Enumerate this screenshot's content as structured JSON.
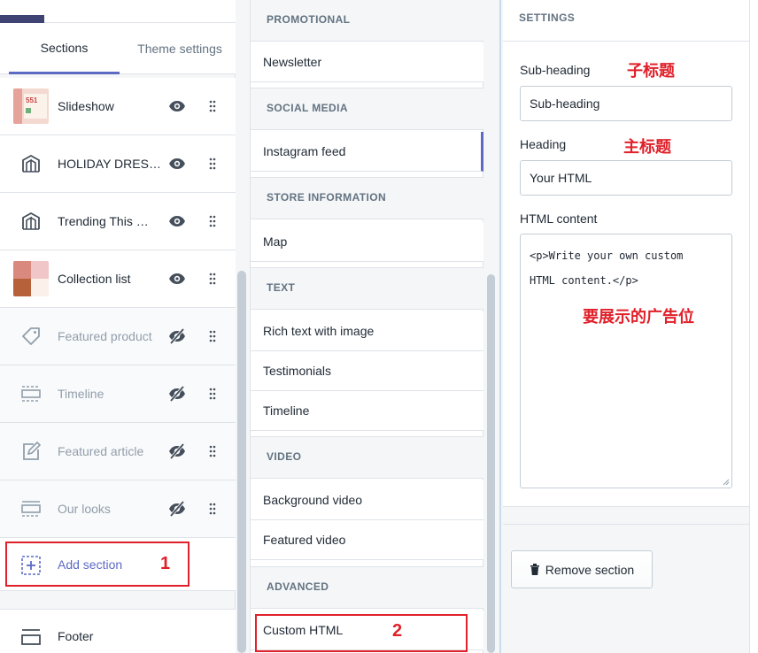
{
  "tabs": {
    "sections": "Sections",
    "theme_settings": "Theme settings"
  },
  "sections": [
    {
      "label": "Slideshow",
      "icon": "image-thumb",
      "visible": true
    },
    {
      "label": "HOLIDAY DRES…",
      "icon": "collection-icon",
      "visible": true
    },
    {
      "label": "Trending This …",
      "icon": "collection-icon",
      "visible": true
    },
    {
      "label": "Collection list",
      "icon": "image-thumb",
      "visible": true
    },
    {
      "label": "Featured product",
      "icon": "tag-icon",
      "visible": false
    },
    {
      "label": "Timeline",
      "icon": "timeline-icon",
      "visible": false
    },
    {
      "label": "Featured article",
      "icon": "article-icon",
      "visible": false
    },
    {
      "label": "Our looks",
      "icon": "looks-icon",
      "visible": false
    }
  ],
  "add_section": {
    "label": "Add section",
    "annotation": "1"
  },
  "footer": {
    "label": "Footer"
  },
  "middle": {
    "groups": [
      {
        "title": "PROMOTIONAL",
        "items": [
          "Newsletter"
        ]
      },
      {
        "title": "SOCIAL MEDIA",
        "items": [
          "Instagram feed"
        ]
      },
      {
        "title": "STORE INFORMATION",
        "items": [
          "Map"
        ]
      },
      {
        "title": "TEXT",
        "items": [
          "Rich text with image",
          "Testimonials",
          "Timeline"
        ]
      },
      {
        "title": "VIDEO",
        "items": [
          "Background video",
          "Featured video"
        ]
      },
      {
        "title": "ADVANCED",
        "items": [
          "Custom HTML"
        ]
      }
    ],
    "custom_annotation": "2"
  },
  "settings": {
    "title": "SETTINGS",
    "subheading_label": "Sub-heading",
    "subheading_value": "Sub-heading",
    "subheading_note": "子标题",
    "heading_label": "Heading",
    "heading_value": "Your HTML",
    "heading_note": "主标题",
    "html_label": "HTML content",
    "html_line1": "<p>Write your own custom",
    "html_line2": "HTML content.</p>",
    "html_note": "要展示的广告位",
    "remove_label": "Remove section"
  },
  "colors": {
    "accent": "#5c6ac4",
    "annotation_red": "#e0202a",
    "dark": "#3f4373"
  }
}
